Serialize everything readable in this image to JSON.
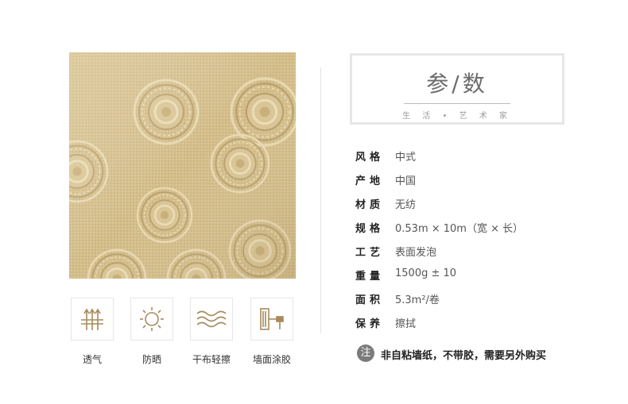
{
  "title": {
    "main": "参/数",
    "sub": "生 活 • 艺 术 家"
  },
  "specs": [
    {
      "key": "风格",
      "value": "中式"
    },
    {
      "key": "产地",
      "value": "中国"
    },
    {
      "key": "材质",
      "value": "无纺"
    },
    {
      "key": "规格",
      "value": "0.53m × 10m（宽 × 长）"
    },
    {
      "key": "工艺",
      "value": "表面发泡"
    },
    {
      "key": "重量",
      "value": "1500g ± 10"
    },
    {
      "key": "面积",
      "value": "5.3m²/卷"
    },
    {
      "key": "保养",
      "value": "擦拭"
    }
  ],
  "features": [
    {
      "label": "透气",
      "icon": "breathable-icon"
    },
    {
      "label": "防晒",
      "icon": "sun-icon"
    },
    {
      "label": "干布轻擦",
      "icon": "wave-icon"
    },
    {
      "label": "墙面涂胶",
      "icon": "paint-roller-icon"
    }
  ],
  "note": {
    "badge": "注",
    "text": "非自粘墙纸，不带胶，需要另外购买"
  },
  "colors": {
    "sample_base": "#d3bd8a",
    "icon_gold": "#a78a5c",
    "badge_gray": "#7b7b7b"
  }
}
